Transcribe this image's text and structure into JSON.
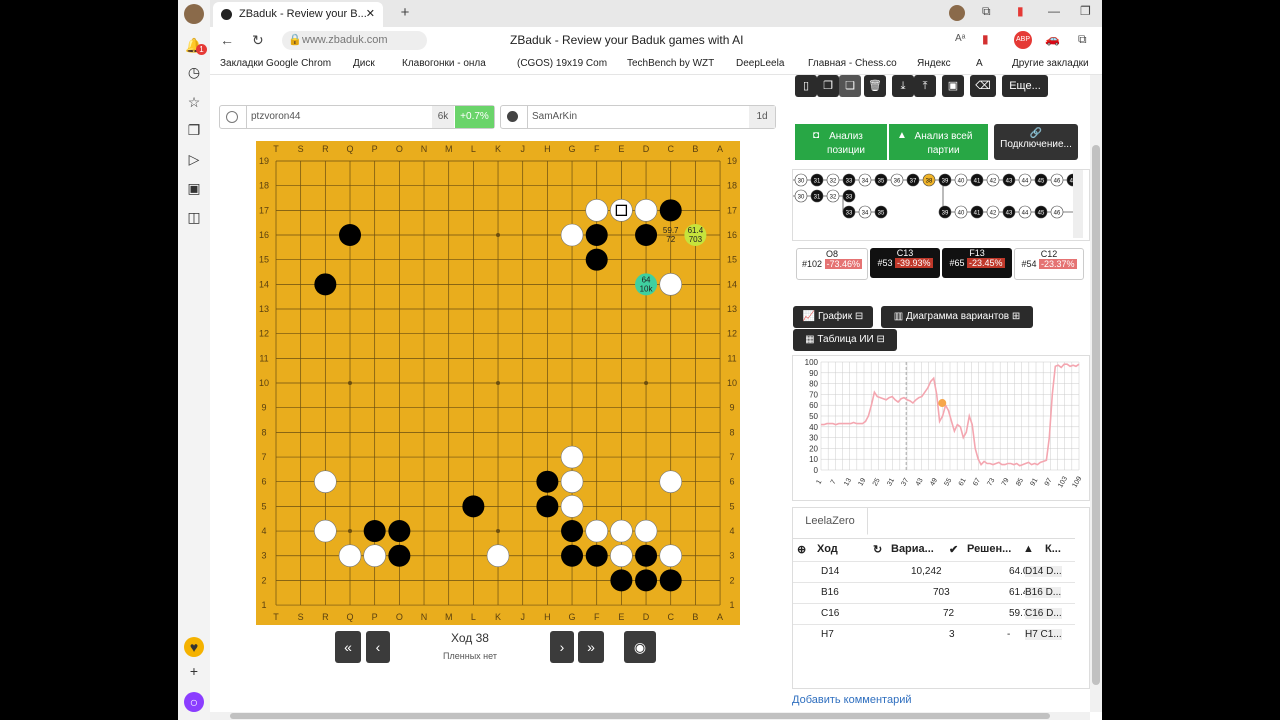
{
  "browser": {
    "tab_title": "ZBaduk - Review your B...",
    "url": "www.zbaduk.com",
    "page_title": "ZBaduk - Review your Baduk games with AI",
    "bookmarks": [
      "Закладки Google Chrom",
      "Диск",
      "Клавогонки - онла",
      "(CGOS) 19x19 Com",
      "TechBench by WZT",
      "DeepLeela",
      "Главная - Chess.co",
      "Яндекс",
      "A"
    ],
    "other_bookmarks": "Другие закладки",
    "badge_count": "1"
  },
  "players": {
    "white": {
      "name": "ptzvoron44",
      "rank": "6k",
      "delta": "+0.7%"
    },
    "black": {
      "name": "SamArKin",
      "rank": "1d"
    }
  },
  "board": {
    "columns": [
      "T",
      "S",
      "R",
      "Q",
      "P",
      "O",
      "N",
      "M",
      "L",
      "K",
      "J",
      "H",
      "G",
      "F",
      "E",
      "D",
      "C",
      "B",
      "A"
    ],
    "rows": [
      "19",
      "18",
      "17",
      "16",
      "15",
      "14",
      "13",
      "12",
      "11",
      "10",
      "9",
      "8",
      "7",
      "6",
      "5",
      "4",
      "3",
      "2",
      "1"
    ],
    "black_stones": [
      "C17",
      "F16",
      "D16",
      "Q16",
      "F15",
      "R14",
      "H6",
      "H5",
      "L5",
      "P4",
      "O4",
      "G4",
      "O3",
      "G3",
      "F3",
      "D3",
      "E2",
      "D2",
      "C2"
    ],
    "white_stones": [
      "F17",
      "D17",
      "G16",
      "C14",
      "G7",
      "R6",
      "G6",
      "C6",
      "G5",
      "R4",
      "F4",
      "E4",
      "D4",
      "Q3",
      "P3",
      "K3",
      "E3",
      "C3"
    ],
    "last_move": "E17",
    "candidates": [
      {
        "point": "D14",
        "value": "64",
        "visits": "10k",
        "color": "#3fd0a0"
      },
      {
        "point": "C16",
        "value": "59.7",
        "visits": "72"
      },
      {
        "point": "B16",
        "value": "61.4",
        "visits": "703",
        "color": "#c6e33c"
      }
    ]
  },
  "toolbar": {
    "more_label": "Еще..."
  },
  "analysis": {
    "position_label": "Анализ позиции",
    "game_label": "Анализ всей партии",
    "connect_label": "Подключение..."
  },
  "move_cards": [
    {
      "coord": "O8",
      "num": "#102",
      "pct": "-73.46%",
      "dark": false
    },
    {
      "coord": "C13",
      "num": "#53",
      "pct": "-39.93%",
      "dark": true
    },
    {
      "coord": "F13",
      "num": "#65",
      "pct": "-23.45%",
      "dark": true
    },
    {
      "coord": "C12",
      "num": "#54",
      "pct": "-23.37%",
      "dark": false
    }
  ],
  "panels": {
    "graph": "График",
    "variants": "Диаграмма вариантов",
    "ai_table": "Таблица ИИ"
  },
  "nav": {
    "move_label": "Ход 38",
    "captures": "Пленных нет"
  },
  "graph": {
    "y_ticks": [
      "100",
      "90",
      "80",
      "70",
      "60",
      "50",
      "40",
      "30",
      "20",
      "10",
      "0"
    ],
    "x_ticks": [
      "1",
      "7",
      "13",
      "19",
      "25",
      "31",
      "37",
      "43",
      "49",
      "55",
      "61",
      "67",
      "73",
      "79",
      "85",
      "91",
      "97",
      "103",
      "109"
    ],
    "line_color": "#f4a6b0",
    "marker_color": "#f6a64a",
    "points": [
      42,
      42,
      43,
      43,
      43,
      42,
      43,
      43,
      43,
      43,
      43,
      44,
      43,
      43,
      43,
      45,
      50,
      60,
      72,
      68,
      67,
      66,
      65,
      67,
      68,
      65,
      63,
      66,
      67,
      65,
      64,
      62,
      65,
      67,
      68,
      72,
      76,
      82,
      85,
      70,
      45,
      50,
      60,
      55,
      45,
      36,
      42,
      40,
      30,
      35,
      50,
      42,
      20,
      10,
      5,
      8,
      6,
      6,
      5,
      6,
      7,
      5,
      5,
      6,
      6,
      5,
      6,
      4,
      5,
      6,
      7,
      5,
      6,
      5,
      7,
      8,
      9,
      30,
      70,
      96,
      97,
      95,
      98,
      98,
      96,
      97,
      96,
      98
    ]
  },
  "ai_table": {
    "engine": "LeelaZero",
    "headers": [
      "Ход",
      "Вариа...",
      "Решен...",
      "К..."
    ],
    "rows": [
      {
        "move": "D14",
        "visits": "10,242",
        "winrate": "64.02%",
        "pv": "D14 D..."
      },
      {
        "move": "B16",
        "visits": "703",
        "winrate": "61.41%",
        "pv": "B16 D..."
      },
      {
        "move": "C16",
        "visits": "72",
        "winrate": "59.70%",
        "pv": "C16 D..."
      },
      {
        "move": "H7",
        "visits": "3",
        "winrate": "-",
        "pv": "H7 C1..."
      }
    ]
  },
  "comment_link": "Добавить комментарий",
  "tree": {
    "row1": [
      "30",
      "31",
      "32",
      "33",
      "34",
      "35",
      "36",
      "37",
      "38",
      "39",
      "40",
      "41",
      "42",
      "43",
      "44",
      "45",
      "46",
      "47"
    ],
    "row2": [
      "30",
      "31",
      "32",
      "33"
    ],
    "row3": [
      "33",
      "34",
      "35"
    ],
    "row4": [
      "39",
      "40",
      "41",
      "42",
      "43",
      "44",
      "45",
      "46"
    ]
  }
}
